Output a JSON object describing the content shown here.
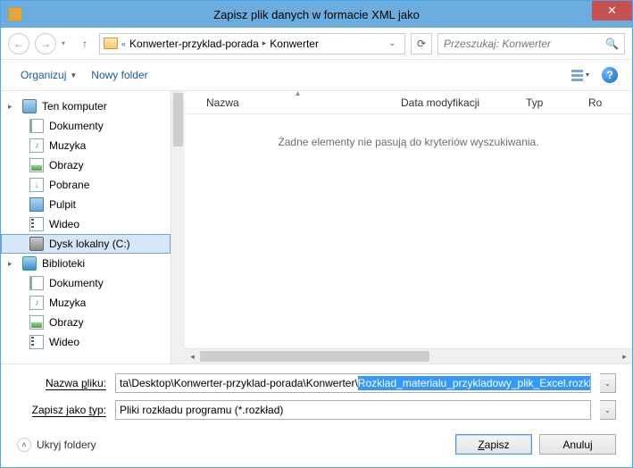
{
  "titlebar": {
    "text": "Zapisz plik danych w formacie XML jako"
  },
  "breadcrumb": {
    "seg1": "Konwerter-przyklad-porada",
    "seg2": "Konwerter"
  },
  "search": {
    "placeholder": "Przeszukaj: Konwerter"
  },
  "toolbar": {
    "organize": "Organizuj",
    "new_folder": "Nowy folder"
  },
  "tree": {
    "this_pc": "Ten komputer",
    "documents": "Dokumenty",
    "music": "Muzyka",
    "pictures": "Obrazy",
    "downloads": "Pobrane",
    "desktop": "Pulpit",
    "videos": "Wideo",
    "local_disk": "Dysk lokalny (C:)",
    "libraries": "Biblioteki",
    "lib_documents": "Dokumenty",
    "lib_music": "Muzyka",
    "lib_pictures": "Obrazy",
    "lib_videos": "Wideo"
  },
  "columns": {
    "name": "Nazwa",
    "date": "Data modyfikacji",
    "type": "Typ",
    "size": "Ro"
  },
  "list": {
    "empty": "Żadne elementy nie pasują do kryteriów wyszukiwania."
  },
  "fields": {
    "filename_label_pre": "Nazwa ",
    "filename_label_u": "p",
    "filename_label_post": "liku:",
    "type_label_pre": "Zapisz jako ",
    "type_label_u": "t",
    "type_label_post": "yp:",
    "filename_value_prefix": "ta\\Desktop\\Konwerter-przyklad-porada\\Konwerter\\",
    "filename_value_sel": "Rozklad_materialu_przykladowy_plik_Excel.rozklad",
    "type_value": "Pliki rozkładu programu (*.rozkład)"
  },
  "actions": {
    "hide": "Ukryj foldery",
    "save_pre": "",
    "save_u": "Z",
    "save_post": "apisz",
    "cancel": "Anuluj"
  }
}
